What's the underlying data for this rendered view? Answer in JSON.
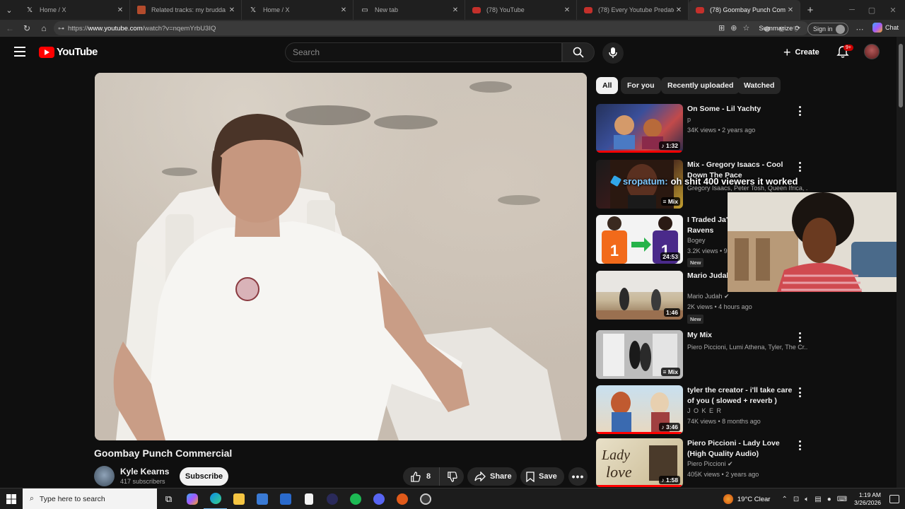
{
  "browser": {
    "tabs": [
      {
        "title": "Home / X",
        "icon": "x-icon"
      },
      {
        "title": "Related tracks: my brudda w suci",
        "icon": "rt-icon"
      },
      {
        "title": "Home / X",
        "icon": "x-icon"
      },
      {
        "title": "New tab",
        "icon": "newtab-icon"
      },
      {
        "title": "(78) YouTube",
        "icon": "youtube-icon"
      },
      {
        "title": "(78) Every Youtube Predator Expl",
        "icon": "youtube-icon"
      },
      {
        "title": "(78) Goombay Punch Commercial",
        "icon": "youtube-icon",
        "active": true
      }
    ],
    "url_prefix": "https://",
    "url_domain": "www.youtube.com",
    "url_path": "/watch?v=nqemYrbU3IQ",
    "summarize_label": "Summarize",
    "signin_label": "Sign in",
    "chat_label": "Chat"
  },
  "youtube": {
    "logo_text": "YouTube",
    "search_placeholder": "Search",
    "create_label": "Create",
    "notif_badge": "9+"
  },
  "video": {
    "title": "Goombay Punch Commercial",
    "channel": "Kyle Kearns",
    "subscribers": "417 subscribers",
    "subscribe_label": "Subscribe",
    "likes": "8",
    "share_label": "Share",
    "save_label": "Save"
  },
  "chips": [
    "All",
    "For you",
    "Recently uploaded",
    "Watched"
  ],
  "recommendations": [
    {
      "title": "On Some - Lil Yachty",
      "channel": "p",
      "meta": "34K views • 2 years ago",
      "duration": "1:32",
      "new": "",
      "watched_fraction": 0.98
    },
    {
      "title": "Mix - Gregory Isaacs - Cool Down The Pace",
      "channel": "Gregory Isaacs, Peter Tosh, Queen Ifrica, ...",
      "meta": "",
      "duration": "Mix",
      "new": "",
      "watched_fraction": 0
    },
    {
      "title": "I Traded Ja'Marr Chase To The Ravens",
      "channel": "Bogey",
      "meta": "3.2K views • 9",
      "duration": "24:53",
      "new": "New",
      "watched_fraction": 0
    },
    {
      "title": "Mario Judah - [Audio Playing]",
      "channel": "Mario Judah",
      "meta": "2K views • 4 hours ago",
      "duration": "1:46",
      "new": "New",
      "watched_fraction": 0
    },
    {
      "title": "My Mix",
      "channel": "Piero Piccioni, Lumi Athena, Tyler, The Cr...",
      "meta": "",
      "duration": "Mix",
      "new": "",
      "watched_fraction": 0
    },
    {
      "title": "tyler the creator - i'll take care of you ( slowed + reverb )",
      "channel": "J O K E R",
      "meta": "74K views • 8 months ago",
      "duration": "3:46",
      "new": "",
      "watched_fraction": 0.98
    },
    {
      "title": "Piero Piccioni - Lady Love (High Quality Audio)",
      "channel": "Piero Piccioni",
      "meta": "405K views • 2 years ago",
      "duration": "1:58",
      "new": "",
      "watched_fraction": 0.98
    }
  ],
  "overlay": {
    "chat_user": "sropatum:",
    "chat_message": "oh shit 400 viewers it worked"
  },
  "taskbar": {
    "search_placeholder": "Type here to search",
    "weather": "19°C  Clear",
    "time": "1:19 AM",
    "date": "3/26/2026"
  },
  "colors": {
    "accent_red": "#ff0000",
    "background": "#0f0f0f",
    "chip_bg": "#272727"
  }
}
